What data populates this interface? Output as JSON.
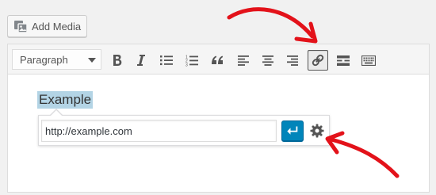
{
  "add_media": {
    "label": "Add Media",
    "icon": "media-icon"
  },
  "toolbar": {
    "format_select": {
      "selected": "Paragraph"
    },
    "buttons": [
      {
        "name": "bold-icon",
        "active": false
      },
      {
        "name": "italic-icon",
        "active": false
      },
      {
        "name": "bulleted-list-icon",
        "active": false
      },
      {
        "name": "numbered-list-icon",
        "active": false
      },
      {
        "name": "blockquote-icon",
        "active": false
      },
      {
        "name": "align-left-icon",
        "active": false
      },
      {
        "name": "align-center-icon",
        "active": false
      },
      {
        "name": "align-right-icon",
        "active": false
      },
      {
        "name": "insert-link-icon",
        "active": true
      },
      {
        "name": "read-more-icon",
        "active": false
      },
      {
        "name": "toolbar-toggle-icon",
        "active": false
      }
    ]
  },
  "content": {
    "selected_text": "Example"
  },
  "link_popup": {
    "url_value": "http://example.com",
    "apply_icon": "enter-arrow-icon",
    "settings_icon": "gear-icon"
  },
  "colors": {
    "accent": "#0085ba",
    "annotation_arrow": "#e3121a",
    "selection": "#b3d4e5"
  }
}
